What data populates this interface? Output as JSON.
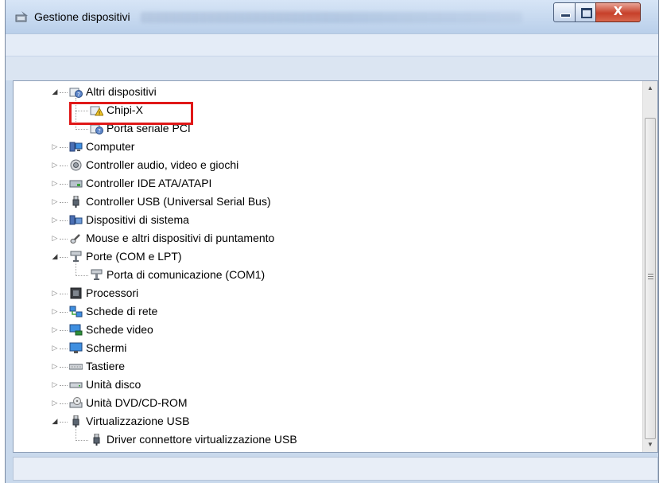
{
  "window": {
    "title": "Gestione dispositivi",
    "buttons": {
      "minimize_icon": "minimize-icon",
      "maximize_icon": "maximize-icon",
      "close_icon": "close-icon",
      "close_glyph": "X"
    }
  },
  "tree": {
    "nodes": [
      {
        "label": "Altri dispositivi",
        "icon": "unknown-device-icon",
        "expanded": true,
        "level": 0
      },
      {
        "label": "Chipi-X",
        "icon": "warning-device-icon",
        "level": 1,
        "highlighted": true
      },
      {
        "label": "Porta seriale PCI",
        "icon": "unknown-device-icon",
        "level": 1
      },
      {
        "label": "Computer",
        "icon": "computer-icon",
        "expanded": false,
        "level": 0
      },
      {
        "label": "Controller audio, video e giochi",
        "icon": "speaker-icon",
        "expanded": false,
        "level": 0
      },
      {
        "label": "Controller IDE ATA/ATAPI",
        "icon": "ide-controller-icon",
        "expanded": false,
        "level": 0
      },
      {
        "label": "Controller USB (Universal Serial Bus)",
        "icon": "usb-plug-icon",
        "expanded": false,
        "level": 0
      },
      {
        "label": "Dispositivi di sistema",
        "icon": "system-device-icon",
        "expanded": false,
        "level": 0
      },
      {
        "label": "Mouse e altri dispositivi di puntamento",
        "icon": "mouse-icon",
        "expanded": false,
        "level": 0
      },
      {
        "label": "Porte (COM e LPT)",
        "icon": "port-icon",
        "expanded": true,
        "level": 0
      },
      {
        "label": "Porta di comunicazione (COM1)",
        "icon": "port-icon",
        "level": 1
      },
      {
        "label": "Processori",
        "icon": "processor-icon",
        "expanded": false,
        "level": 0
      },
      {
        "label": "Schede di rete",
        "icon": "network-adapter-icon",
        "expanded": false,
        "level": 0
      },
      {
        "label": "Schede video",
        "icon": "display-adapter-icon",
        "expanded": false,
        "level": 0
      },
      {
        "label": "Schermi",
        "icon": "monitor-icon",
        "expanded": false,
        "level": 0
      },
      {
        "label": "Tastiere",
        "icon": "keyboard-icon",
        "expanded": false,
        "level": 0
      },
      {
        "label": "Unità disco",
        "icon": "disk-drive-icon",
        "expanded": false,
        "level": 0
      },
      {
        "label": "Unità DVD/CD-ROM",
        "icon": "dvd-drive-icon",
        "expanded": false,
        "level": 0
      },
      {
        "label": "Virtualizzazione USB",
        "icon": "usb-plug-icon",
        "expanded": true,
        "level": 0
      },
      {
        "label": "Driver connettore virtualizzazione USB",
        "icon": "usb-plug-icon",
        "level": 1
      }
    ]
  },
  "colors": {
    "highlight_border": "#e01818",
    "titlebar": "#c9d9ec",
    "close_button": "#c7402a"
  }
}
